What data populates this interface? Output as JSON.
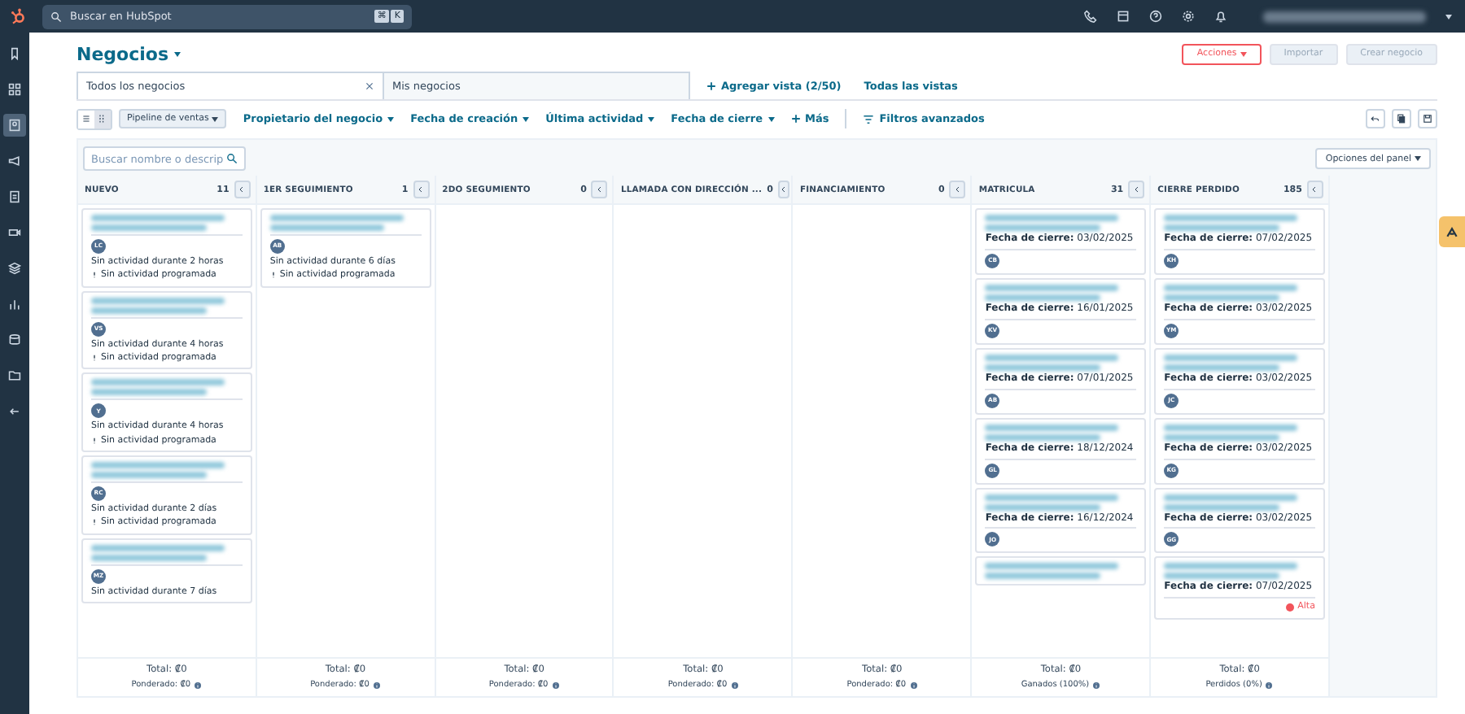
{
  "top_bar": {
    "search_placeholder": "Buscar en HubSpot",
    "shortcut_keys": [
      "⌘",
      "K"
    ]
  },
  "sidebar": {
    "items": [
      {
        "selected": false
      },
      {
        "selected": false
      },
      {
        "selected": true
      },
      {
        "selected": false
      },
      {
        "selected": false
      },
      {
        "selected": false
      },
      {
        "selected": false
      },
      {
        "selected": false
      },
      {
        "selected": false
      },
      {
        "selected": false
      },
      {
        "selected": false
      }
    ]
  },
  "page": {
    "title": "Negocios",
    "actions": [
      {
        "label": "Acciones",
        "kind": "outline",
        "disabled": false
      },
      {
        "label": "Importar",
        "kind": "plain",
        "disabled": true
      },
      {
        "label": "Crear negocio",
        "kind": "plain",
        "disabled": true
      }
    ]
  },
  "tabs": [
    {
      "label": "Todos los negocios",
      "selected": true
    },
    {
      "label": "Mis negocios",
      "selected": false
    }
  ],
  "view_links": [
    "Agregar vista (2/50)",
    "Todas las vistas"
  ],
  "view_toggle": [
    {
      "selected": false
    },
    {
      "selected": true
    }
  ],
  "filters": {
    "pipeline": "Pipeline de ventas",
    "items": [
      "Propietario del negocio",
      "Fecha de creación",
      "Última actividad",
      "Fecha de cierre"
    ],
    "more": "Más",
    "advanced": "Filtros avanzados"
  },
  "board": {
    "search_placeholder": "Buscar nombre o descrip",
    "options": "Opciones del panel",
    "columns": [
      {
        "title": "NUEVO",
        "count": "11",
        "cards": [
          {
            "kind": "activity",
            "avatar": "LC",
            "activity": "Sin actividad durante 2 horas",
            "scheduled": "Sin actividad programada"
          },
          {
            "kind": "activity",
            "avatar": "VS",
            "activity": "Sin actividad durante 4 horas",
            "scheduled": "Sin actividad programada"
          },
          {
            "kind": "activity",
            "avatar": "Y",
            "activity": "Sin actividad durante 4 horas",
            "scheduled": "Sin actividad programada"
          },
          {
            "kind": "activity",
            "avatar": "RC",
            "activity": "Sin actividad durante 2 días",
            "scheduled": "Sin actividad programada"
          },
          {
            "kind": "activity",
            "avatar": "MZ",
            "activity": "Sin actividad durante 7 días"
          }
        ],
        "footer": {
          "total": "Total: ₡0",
          "secondary": "Ponderado: ₡0"
        }
      },
      {
        "title": "1ER SEGUIMIENTO",
        "count": "1",
        "cards": [
          {
            "kind": "activity",
            "avatar": "AB",
            "activity": "Sin actividad durante 6 días",
            "scheduled": "Sin actividad programada"
          }
        ],
        "footer": {
          "total": "Total: ₡0",
          "secondary": "Ponderado: ₡0"
        }
      },
      {
        "title": "2DO SEGUMIENTO",
        "count": "0",
        "footer": {
          "total": "Total: ₡0",
          "secondary": "Ponderado: ₡0"
        }
      },
      {
        "title": "LLAMADA CON DIRECCIÓN ...",
        "count": "0",
        "footer": {
          "total": "Total: ₡0",
          "secondary": "Ponderado: ₡0"
        }
      },
      {
        "title": "FINANCIAMIENTO",
        "count": "0",
        "footer": {
          "total": "Total: ₡0",
          "secondary": "Ponderado: ₡0"
        }
      },
      {
        "title": "MATRICULA",
        "count": "31",
        "cards": [
          {
            "kind": "close_date",
            "date_label": "Fecha de cierre:",
            "date": "03/02/2025",
            "avatar": "CB"
          },
          {
            "kind": "close_date",
            "date_label": "Fecha de cierre:",
            "date": "16/01/2025",
            "avatar": "KV"
          },
          {
            "kind": "close_date",
            "date_label": "Fecha de cierre:",
            "date": "07/01/2025",
            "avatar": "AB"
          },
          {
            "kind": "close_date",
            "date_label": "Fecha de cierre:",
            "date": "18/12/2024",
            "avatar": "GL"
          },
          {
            "kind": "close_date",
            "date_label": "Fecha de cierre:",
            "date": "16/12/2024",
            "avatar": "JO"
          },
          {
            "kind": "close_date"
          }
        ],
        "footer": {
          "total": "Total: ₡0",
          "secondary": "Ganados (100%)"
        }
      },
      {
        "title": "CIERRE PERDIDO",
        "count": "185",
        "cards": [
          {
            "kind": "close_date",
            "date_label": "Fecha de cierre:",
            "date": "07/02/2025",
            "avatar": "KH"
          },
          {
            "kind": "close_date",
            "date_label": "Fecha de cierre:",
            "date": "03/02/2025",
            "avatar": "YM"
          },
          {
            "kind": "close_date",
            "date_label": "Fecha de cierre:",
            "date": "03/02/2025",
            "avatar": "JC"
          },
          {
            "kind": "close_date",
            "date_label": "Fecha de cierre:",
            "date": "03/02/2025",
            "avatar": "KG"
          },
          {
            "kind": "close_date",
            "date_label": "Fecha de cierre:",
            "date": "03/02/2025",
            "avatar": "GG"
          },
          {
            "kind": "close_date",
            "date_label": "Fecha de cierre:",
            "date": "07/02/2025",
            "priority": "Alta",
            "color": "#f2545b"
          }
        ],
        "footer": {
          "total": "Total: ₡0",
          "secondary": "Perdidos (0%)"
        }
      }
    ]
  }
}
